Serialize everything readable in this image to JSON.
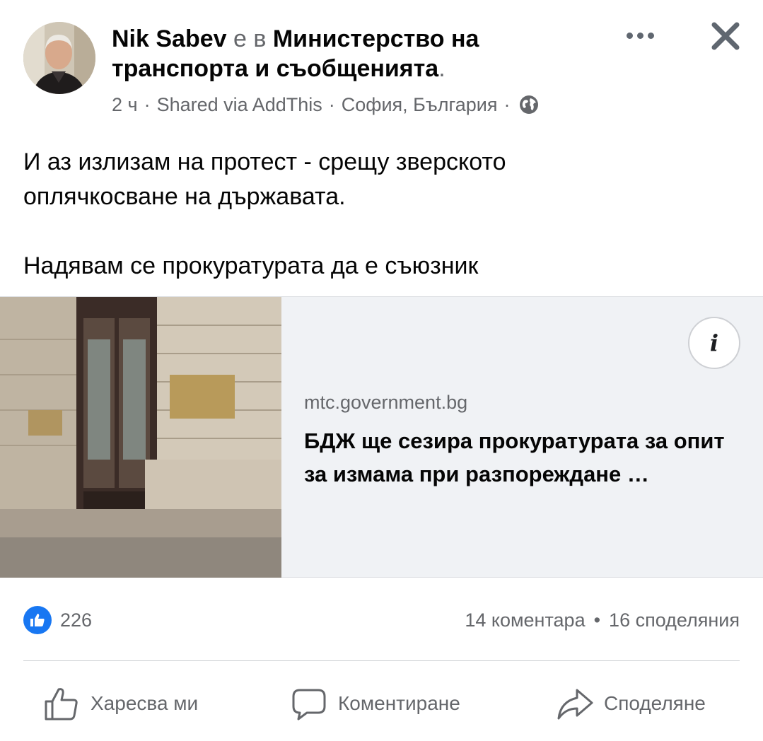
{
  "post": {
    "author": "Nik Sabev",
    "is_in": " е в ",
    "place": "Министерство на транспорта и съобщенията",
    "period": ".",
    "time": "2 ч",
    "via": "Shared via AddThis",
    "location": "София, България",
    "sep": "·",
    "text_line1": "И аз излизам на протест - срещу зверското",
    "text_line2": "оплячкосване на държавата.",
    "text_line3": "Надявам се прокуратурата да е съюзник"
  },
  "link": {
    "domain": "mtc.government.bg",
    "headline": "БДЖ ще сезира прокуратурата за опит за измама при разпореждане …",
    "info_label": "i"
  },
  "stats": {
    "reactions": "226",
    "comments": "14 коментара",
    "bullet": "•",
    "shares": "16 споделяния"
  },
  "actions": {
    "like": "Харесва ми",
    "comment": "Коментиране",
    "share": "Споделяне"
  },
  "icons": {
    "globe": "globe-icon",
    "more": "more-icon",
    "close": "close-icon",
    "like": "thumbs-up-icon",
    "comment": "comment-icon",
    "share": "share-icon"
  },
  "colors": {
    "accent": "#1877f2",
    "secondary_text": "#65676b",
    "link_bg": "#f0f2f5"
  }
}
